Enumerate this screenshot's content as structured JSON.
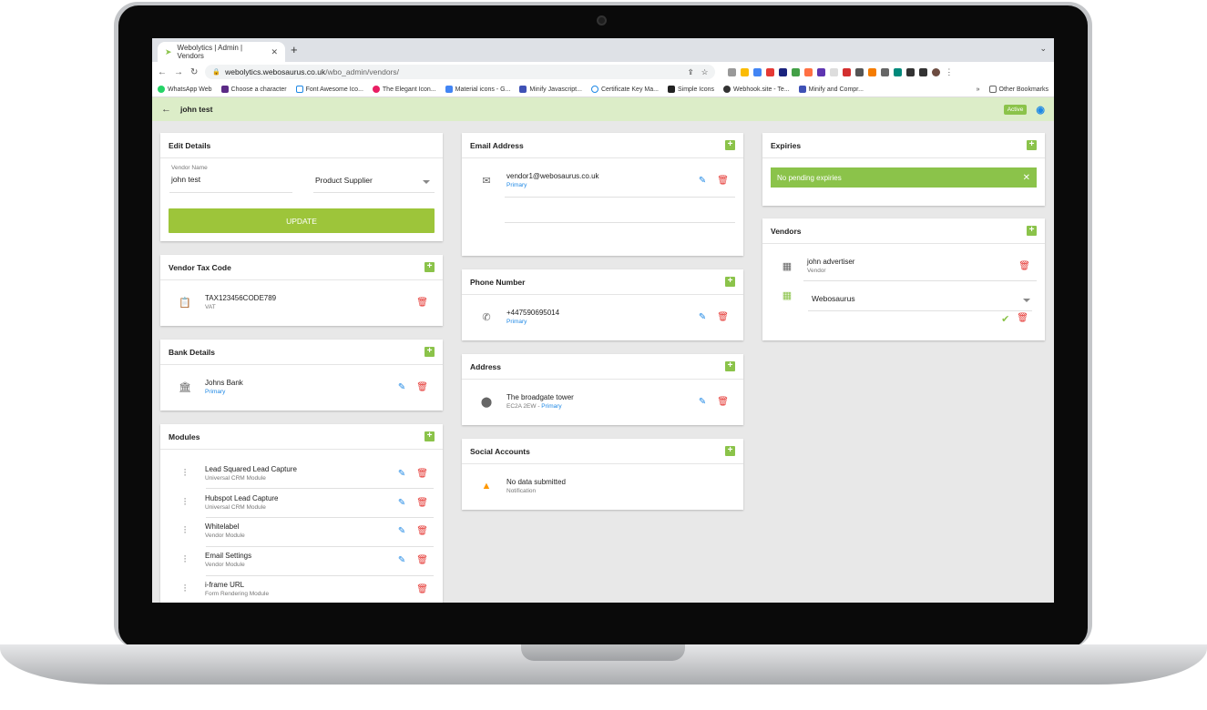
{
  "browser": {
    "tab_title": "Webolytics | Admin | Vendors",
    "url_host": "webolytics.webosaurus.co.uk",
    "url_path": "/wbo_admin/vendors/",
    "bookmarks": [
      "WhatsApp Web",
      "Choose a character",
      "Font Awesome Ico...",
      "The Elegant Icon...",
      "Material icons - G...",
      "Minify Javascript...",
      "Certificate Key Ma...",
      "Simple Icons",
      "Webhook.site - Te...",
      "Minify and Compr..."
    ],
    "other_bookmarks": "Other Bookmarks",
    "overflow": "»"
  },
  "appbar": {
    "title": "john test",
    "status": "Active"
  },
  "edit_details": {
    "title": "Edit Details",
    "vendor_name_label": "Vendor Name",
    "vendor_name": "john test",
    "type": "Product Supplier",
    "update_label": "UPDATE"
  },
  "tax_code": {
    "title": "Vendor Tax Code",
    "code": "TAX123456CODE789",
    "type": "VAT"
  },
  "bank": {
    "title": "Bank Details",
    "name": "Johns Bank",
    "tag": "Primary"
  },
  "modules": {
    "title": "Modules",
    "items": [
      {
        "name": "Lead Squared Lead Capture",
        "type": "Universal CRM Module"
      },
      {
        "name": "Hubspot Lead Capture",
        "type": "Universal CRM Module"
      },
      {
        "name": "Whitelabel",
        "type": "Vendor Module"
      },
      {
        "name": "Email Settings",
        "type": "Vendor Module"
      },
      {
        "name": "i-frame URL",
        "type": "Form Rendering Module"
      }
    ]
  },
  "email": {
    "title": "Email Address",
    "address": "vendor1@webosaurus.co.uk",
    "tag": "Primary"
  },
  "phone": {
    "title": "Phone Number",
    "number": "+447590695014",
    "tag": "Primary"
  },
  "address": {
    "title": "Address",
    "line": "The broadgate tower",
    "postcode": "EC2A 2EW",
    "sep": " - ",
    "tag": "Primary"
  },
  "social": {
    "title": "Social Accounts",
    "empty": "No data submitted",
    "sub": "Notification"
  },
  "expiries": {
    "title": "Expiries",
    "alert": "No pending expiries"
  },
  "vendors": {
    "title": "Vendors",
    "name": "john advertiser",
    "role": "Vendor",
    "select": "Webosaurus"
  }
}
